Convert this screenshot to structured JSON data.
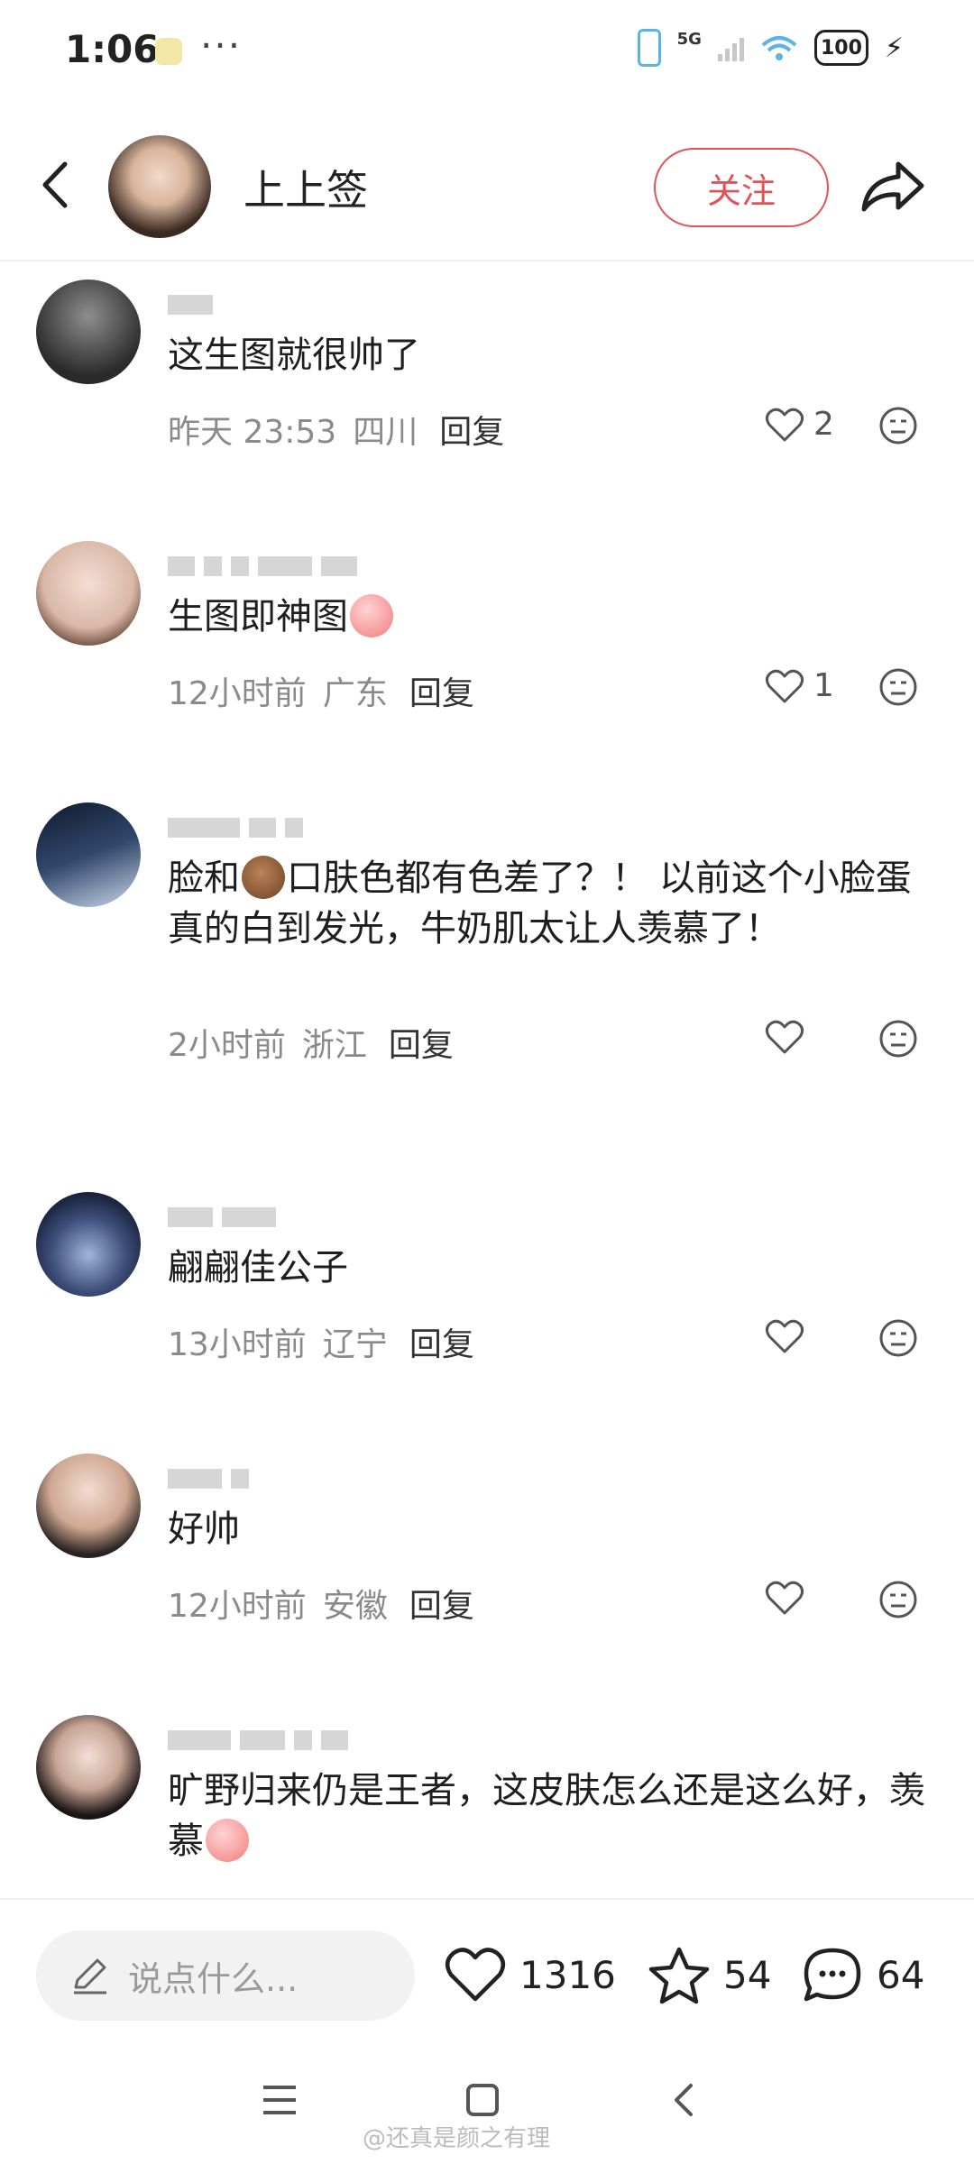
{
  "status_bar": {
    "time": "1:06",
    "more": "···",
    "network": "5G",
    "battery": "100"
  },
  "header": {
    "title": "上上签",
    "follow_label": "关注"
  },
  "comments": [
    {
      "text": "这生图就很帅了",
      "time": "昨天 23:53",
      "location": "四川",
      "reply": "回复",
      "likes": "2"
    },
    {
      "text": "生图即神图",
      "time": "12小时前",
      "location": "广东",
      "reply": "回复",
      "likes": "1"
    },
    {
      "text_parts": [
        "脸和",
        "口肤色都有色差了？！ 以前这个小脸蛋真的白到发光，牛奶肌太让人羡慕了！"
      ],
      "time": "2小时前",
      "location": "浙江",
      "reply": "回复",
      "likes": ""
    },
    {
      "text": "翩翩佳公子",
      "time": "13小时前",
      "location": "辽宁",
      "reply": "回复",
      "likes": ""
    },
    {
      "text": "好帅",
      "time": "12小时前",
      "location": "安徽",
      "reply": "回复",
      "likes": ""
    },
    {
      "text": "旷野归来仍是王者，这皮肤怎么还是这么好，羡慕"
    }
  ],
  "bottom_bar": {
    "input_placeholder": "说点什么...",
    "likes": "1316",
    "favorites": "54",
    "comments": "64"
  },
  "watermark": "@还真是颜之有理",
  "colors": {
    "accent": "#e05358",
    "meta_text": "#8a8a8a"
  },
  "icons": [
    "back-icon",
    "share-icon",
    "heart-icon",
    "emoji-icon",
    "pencil-icon",
    "star-icon",
    "comment-bubble-icon",
    "menu-icon",
    "home-square-icon",
    "nav-back-icon"
  ]
}
